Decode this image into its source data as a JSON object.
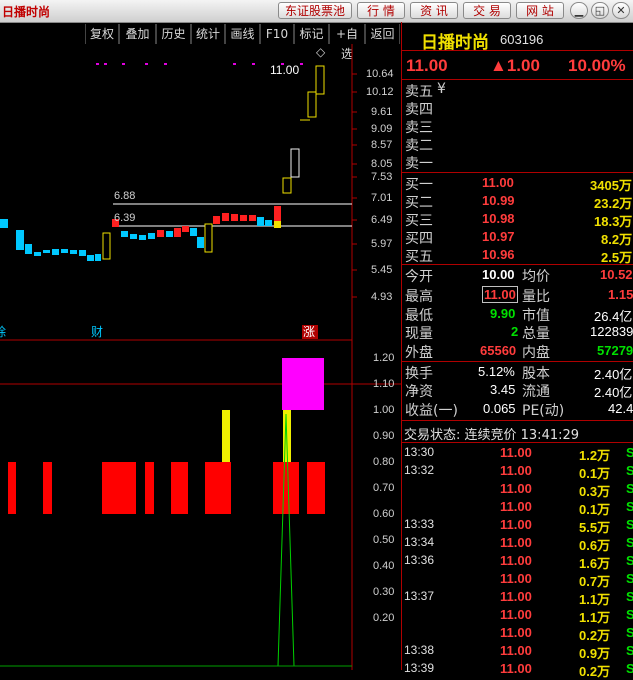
{
  "app_title": "日播时尚",
  "titlebar": {
    "buttons": [
      "东证股票池",
      "行 情",
      "资 讯",
      "交 易",
      "网 站"
    ],
    "window": [
      "▁",
      "◱",
      "✕"
    ]
  },
  "toolbar": {
    "tabs": [
      "复权",
      "叠加",
      "历史",
      "统计",
      "画线",
      "F10",
      "标记",
      "+自选",
      "返回"
    ]
  },
  "kline": {
    "price_axis": [
      "10.64",
      "10.12",
      "9.61",
      "9.09",
      "8.57",
      "8.05",
      "7.53",
      "7.01",
      "6.49",
      "5.97",
      "5.45",
      "4.93"
    ],
    "annotations": {
      "high": "11.00",
      "line1": "6.88",
      "line2": "6.39"
    },
    "markers": {
      "left": "除",
      "mid": "财",
      "right": "涨"
    }
  },
  "indicator": {
    "axis": [
      "1.20",
      "1.10",
      "1.00",
      "0.90",
      "0.80",
      "0.70",
      "0.60",
      "0.50",
      "0.40",
      "0.30",
      "0.20"
    ]
  },
  "quote": {
    "name": "日播时尚",
    "code": "603196",
    "price": "11.00",
    "change": "▲1.00",
    "change_pct": "10.00%",
    "sell": [
      {
        "label": "卖五",
        "price": "",
        "vol": "",
        "mark": "¥"
      },
      {
        "label": "卖四",
        "price": "",
        "vol": ""
      },
      {
        "label": "卖三",
        "price": "",
        "vol": ""
      },
      {
        "label": "卖二",
        "price": "",
        "vol": ""
      },
      {
        "label": "卖一",
        "price": "",
        "vol": ""
      }
    ],
    "buy": [
      {
        "label": "买一",
        "price": "11.00",
        "vol": "3405万"
      },
      {
        "label": "买二",
        "price": "10.99",
        "vol": "23.2万"
      },
      {
        "label": "买三",
        "price": "10.98",
        "vol": "18.3万"
      },
      {
        "label": "买四",
        "price": "10.97",
        "vol": "8.2万"
      },
      {
        "label": "买五",
        "price": "10.96",
        "vol": "2.5万"
      }
    ],
    "stats": [
      {
        "l1": "今开",
        "v1": "10.00",
        "l2": "均价",
        "v2": "10.52"
      },
      {
        "l1": "最高",
        "v1": "11.00",
        "l2": "量比",
        "v2": "1.15"
      },
      {
        "l1": "最低",
        "v1": "9.90",
        "l2": "市值",
        "v2": "26.4亿"
      },
      {
        "l1": "现量",
        "v1": "2",
        "l2": "总量",
        "v2": "122839"
      },
      {
        "l1": "外盘",
        "v1": "65560",
        "l2": "内盘",
        "v2": "57279"
      }
    ],
    "stats2": [
      {
        "l1": "换手",
        "v1": "5.12%",
        "l2": "股本",
        "v2": "2.40亿"
      },
      {
        "l1": "净资",
        "v1": "3.45",
        "l2": "流通",
        "v2": "2.40亿"
      },
      {
        "l1": "收益(一)",
        "v1": "0.065",
        "l2": "PE(动)",
        "v2": "42.4"
      }
    ],
    "trade_status": "交易状态: 连续竞价 13:41:29",
    "ticks": [
      {
        "time": "13:30",
        "price": "11.00",
        "vol": "1.2万",
        "flag": "S"
      },
      {
        "time": "13:32",
        "price": "11.00",
        "vol": "0.1万",
        "flag": "S"
      },
      {
        "time": "",
        "price": "11.00",
        "vol": "0.3万",
        "flag": "S"
      },
      {
        "time": "",
        "price": "11.00",
        "vol": "0.1万",
        "flag": "S"
      },
      {
        "time": "13:33",
        "price": "11.00",
        "vol": "5.5万",
        "flag": "S"
      },
      {
        "time": "13:34",
        "price": "11.00",
        "vol": "0.6万",
        "flag": "S"
      },
      {
        "time": "13:36",
        "price": "11.00",
        "vol": "1.6万",
        "flag": "S"
      },
      {
        "time": "",
        "price": "11.00",
        "vol": "0.7万",
        "flag": "S"
      },
      {
        "time": "13:37",
        "price": "11.00",
        "vol": "1.1万",
        "flag": "S"
      },
      {
        "time": "",
        "price": "11.00",
        "vol": "1.1万",
        "flag": "S"
      },
      {
        "time": "",
        "price": "11.00",
        "vol": "0.2万",
        "flag": "S"
      },
      {
        "time": "13:38",
        "price": "11.00",
        "vol": "0.9万",
        "flag": "S"
      },
      {
        "time": "13:39",
        "price": "11.00",
        "vol": "0.2万",
        "flag": "S"
      }
    ]
  }
}
